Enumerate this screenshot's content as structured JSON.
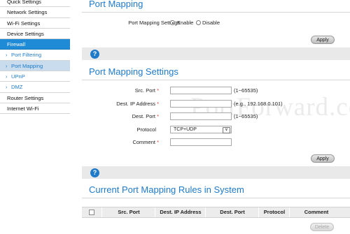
{
  "sidebar": {
    "items": [
      {
        "label": "Quick Settings"
      },
      {
        "label": "Network Settings"
      },
      {
        "label": "Wi-Fi Settings"
      },
      {
        "label": "Device Settings"
      },
      {
        "label": "Firewall"
      },
      {
        "label": "Port Filtering"
      },
      {
        "label": "Port Mapping"
      },
      {
        "label": "UPnP"
      },
      {
        "label": "DMZ"
      },
      {
        "label": "Router Settings"
      },
      {
        "label": "Internet Wi-Fi"
      }
    ],
    "chevron": "›"
  },
  "section1": {
    "title": "Port Mapping",
    "settings_label": "Port Mapping Settings",
    "enable_label": "Enable",
    "disable_label": "Disable",
    "selected": "Enable",
    "apply_label": "Apply"
  },
  "help_icon": "?",
  "section2": {
    "title": "Port Mapping Settings",
    "src_port_label": "Src. Port",
    "src_port_hint": "(1~65535)",
    "dest_ip_label": "Dest. IP Address",
    "dest_ip_hint": "(e.g., 192.168.0.101)",
    "dest_port_label": "Dest. Port",
    "dest_port_hint": "(1~65535)",
    "protocol_label": "Protocol",
    "protocol_value": "TCP+UDP",
    "comment_label": "Comment",
    "required_mark": "*",
    "apply_label": "Apply",
    "watermark": "PortForward.com"
  },
  "section3": {
    "title": "Current Port Mapping Rules in System",
    "columns": [
      "Src. Port",
      "Dest. IP Address",
      "Dest. Port",
      "Protocol",
      "Comment"
    ],
    "delete_label": "Delete"
  },
  "colors": {
    "accent": "#1f7ac9",
    "active_nav": "#1f8ad6",
    "required": "#e23b3b"
  }
}
